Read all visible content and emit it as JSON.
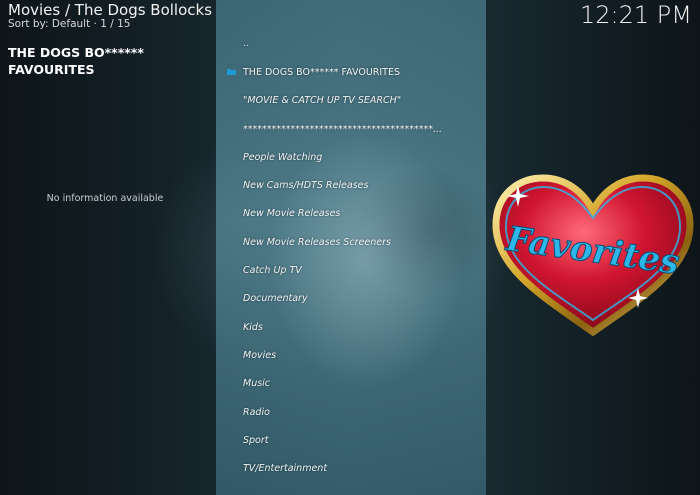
{
  "header": {
    "title": "Movies / The Dogs Bollocks",
    "sort_info": "Sort by: Default  ·  1 / 15",
    "clock": "12:21 PM"
  },
  "info_panel": {
    "title_line1": "THE DOGS BO******",
    "title_line2": "FAVOURITES",
    "no_info": "No information available"
  },
  "list": {
    "items": [
      {
        "label": ".."
      },
      {
        "label": "THE DOGS BO****** FAVOURITES"
      },
      {
        "label": "\"MOVIE &  CATCH UP TV SEARCH\""
      },
      {
        "label": "****************************************..."
      },
      {
        "label": "People Watching"
      },
      {
        "label": "New Cams/HDTS Releases"
      },
      {
        "label": "New Movie Releases"
      },
      {
        "label": "New Movie Releases Screeners"
      },
      {
        "label": "Catch Up TV"
      },
      {
        "label": "Documentary"
      },
      {
        "label": "Kids"
      },
      {
        "label": "Movies"
      },
      {
        "label": "Music"
      },
      {
        "label": "Radio"
      },
      {
        "label": "Sport"
      },
      {
        "label": "TV/Entertainment"
      }
    ]
  },
  "artwork": {
    "word": "Favorites"
  },
  "colors": {
    "heart_red": "#c8102e",
    "heart_gold": "#d4a62a",
    "text_blue": "#2fb6e8",
    "folder_blue": "#1e9bd7"
  }
}
